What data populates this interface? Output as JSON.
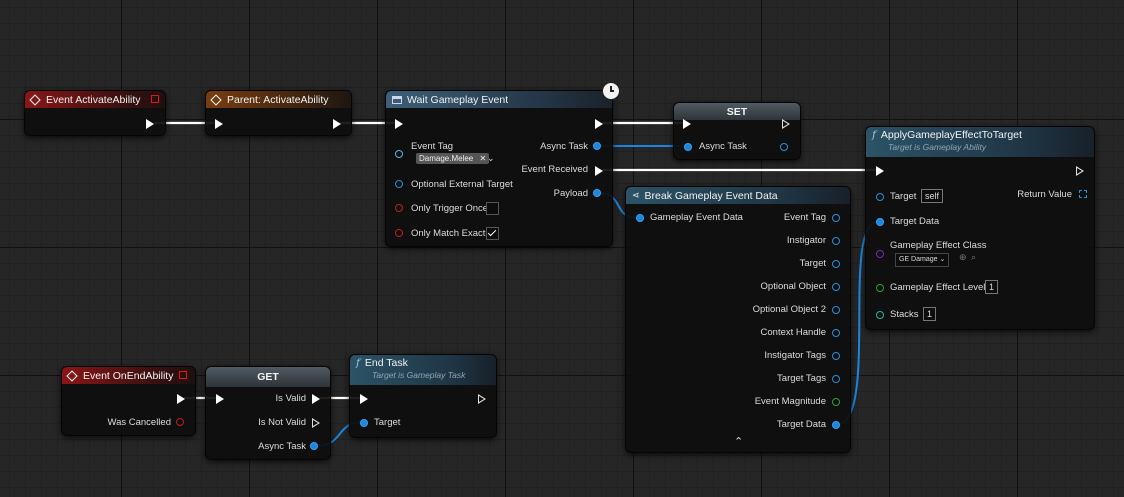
{
  "nodes": {
    "event_activate": {
      "title": "Event ActivateAbility"
    },
    "parent_activate": {
      "title": "Parent: ActivateAbility"
    },
    "wait_event": {
      "title": "Wait Gameplay Event",
      "event_tag_label": "Event Tag",
      "event_tag_value": "Damage.Melee",
      "optional_target_label": "Optional External Target",
      "trigger_once_label": "Only Trigger Once",
      "match_exact_label": "Only Match Exact",
      "trigger_once_checked": false,
      "match_exact_checked": true,
      "async_task_label": "Async Task",
      "event_received_label": "Event Received",
      "payload_label": "Payload"
    },
    "set": {
      "title": "SET",
      "async_task_label": "Async Task"
    },
    "apply_effect": {
      "title": "ApplyGameplayEffectToTarget",
      "subtitle": "Target is Gameplay Ability",
      "target_label": "Target",
      "target_value": "self",
      "return_label": "Return Value",
      "target_data_label": "Target Data",
      "effect_class_label": "Gameplay Effect Class",
      "effect_class_value": "GE Damage",
      "effect_level_label": "Gameplay Effect Level",
      "effect_level_value": "1",
      "stacks_label": "Stacks",
      "stacks_value": "1"
    },
    "break_event": {
      "title": "Break Gameplay Event Data",
      "input_label": "Gameplay Event Data",
      "outputs": [
        "Event Tag",
        "Instigator",
        "Target",
        "Optional Object",
        "Optional Object 2",
        "Context Handle",
        "Instigator Tags",
        "Target Tags",
        "Event Magnitude",
        "Target Data"
      ]
    },
    "event_end": {
      "title": "Event OnEndAbility",
      "was_cancelled_label": "Was Cancelled"
    },
    "get": {
      "title": "GET",
      "is_valid_label": "Is Valid",
      "is_not_valid_label": "Is Not Valid",
      "async_task_label": "Async Task"
    },
    "end_task": {
      "title": "End Task",
      "subtitle": "Target is Gameplay Task",
      "target_label": "Target"
    }
  },
  "colors": {
    "exec": "#ffffff",
    "object_pin": "#2b8fd6",
    "bool_pin": "#c21e1e",
    "float_pin": "#2ea23a",
    "class_pin": "#7a28b8",
    "struct_pin": "#29b5a5"
  }
}
